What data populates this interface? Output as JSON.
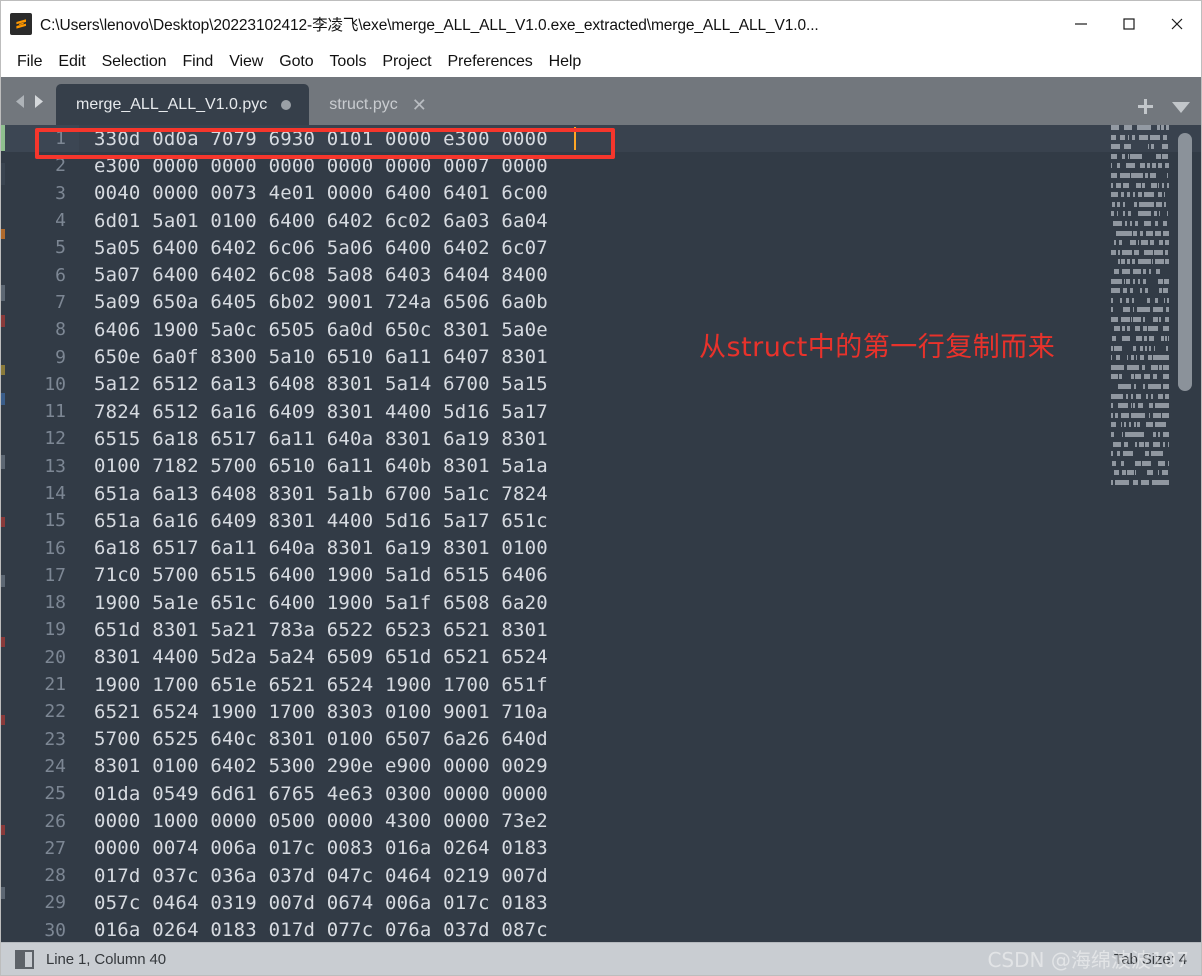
{
  "window": {
    "title": "C:\\Users\\lenovo\\Desktop\\20223102412-李凌飞\\exe\\merge_ALL_ALL_V1.0.exe_extracted\\merge_ALL_ALL_V1.0...",
    "app_icon": "sublime-text-icon",
    "minimize_label": "—",
    "maximize_label": "☐",
    "close_label": "✕"
  },
  "menubar": {
    "items": [
      {
        "label": "File"
      },
      {
        "label": "Edit"
      },
      {
        "label": "Selection"
      },
      {
        "label": "Find"
      },
      {
        "label": "View"
      },
      {
        "label": "Goto"
      },
      {
        "label": "Tools"
      },
      {
        "label": "Project"
      },
      {
        "label": "Preferences"
      },
      {
        "label": "Help"
      }
    ]
  },
  "tabbar": {
    "prev_icon": "chevron-left-icon",
    "next_icon": "chevron-right-icon",
    "new_tab_icon": "plus-icon",
    "tab_menu_icon": "chevron-down-icon",
    "tabs": [
      {
        "label": "merge_ALL_ALL_V1.0.pyc",
        "active": true,
        "dirty": true,
        "close_label": ""
      },
      {
        "label": "struct.pyc",
        "active": false,
        "dirty": false,
        "close_label": "✕"
      }
    ]
  },
  "editor": {
    "cursor_line": 1,
    "lines": [
      {
        "n": "1",
        "text": "330d 0d0a 7079 6930 0101 0000 e300 0000"
      },
      {
        "n": "2",
        "text": "e300 0000 0000 0000 0000 0000 0007 0000"
      },
      {
        "n": "3",
        "text": "0040 0000 0073 4e01 0000 6400 6401 6c00"
      },
      {
        "n": "4",
        "text": "6d01 5a01 0100 6400 6402 6c02 6a03 6a04"
      },
      {
        "n": "5",
        "text": "5a05 6400 6402 6c06 5a06 6400 6402 6c07"
      },
      {
        "n": "6",
        "text": "5a07 6400 6402 6c08 5a08 6403 6404 8400"
      },
      {
        "n": "7",
        "text": "5a09 650a 6405 6b02 9001 724a 6506 6a0b"
      },
      {
        "n": "8",
        "text": "6406 1900 5a0c 6505 6a0d 650c 8301 5a0e"
      },
      {
        "n": "9",
        "text": "650e 6a0f 8300 5a10 6510 6a11 6407 8301"
      },
      {
        "n": "10",
        "text": "5a12 6512 6a13 6408 8301 5a14 6700 5a15"
      },
      {
        "n": "11",
        "text": "7824 6512 6a16 6409 8301 4400 5d16 5a17"
      },
      {
        "n": "12",
        "text": "6515 6a18 6517 6a11 640a 8301 6a19 8301"
      },
      {
        "n": "13",
        "text": "0100 7182 5700 6510 6a11 640b 8301 5a1a"
      },
      {
        "n": "14",
        "text": "651a 6a13 6408 8301 5a1b 6700 5a1c 7824"
      },
      {
        "n": "15",
        "text": "651a 6a16 6409 8301 4400 5d16 5a17 651c"
      },
      {
        "n": "16",
        "text": "6a18 6517 6a11 640a 8301 6a19 8301 0100"
      },
      {
        "n": "17",
        "text": "71c0 5700 6515 6400 1900 5a1d 6515 6406"
      },
      {
        "n": "18",
        "text": "1900 5a1e 651c 6400 1900 5a1f 6508 6a20"
      },
      {
        "n": "19",
        "text": "651d 8301 5a21 783a 6522 6523 6521 8301"
      },
      {
        "n": "20",
        "text": "8301 4400 5d2a 5a24 6509 651d 6521 6524"
      },
      {
        "n": "21",
        "text": "1900 1700 651e 6521 6524 1900 1700 651f"
      },
      {
        "n": "22",
        "text": "6521 6524 1900 1700 8303 0100 9001 710a"
      },
      {
        "n": "23",
        "text": "5700 6525 640c 8301 0100 6507 6a26 640d"
      },
      {
        "n": "24",
        "text": "8301 0100 6402 5300 290e e900 0000 0029"
      },
      {
        "n": "25",
        "text": "01da 0549 6d61 6765 4e63 0300 0000 0000"
      },
      {
        "n": "26",
        "text": "0000 1000 0000 0500 0000 4300 0000 73e2"
      },
      {
        "n": "27",
        "text": "0000 0074 006a 017c 0083 016a 0264 0183"
      },
      {
        "n": "28",
        "text": "017d 037c 036a 037d 047c 0464 0219 007d"
      },
      {
        "n": "29",
        "text": "057c 0464 0319 007d 0674 006a 017c 0183"
      },
      {
        "n": "30",
        "text": "016a 0264 0183 017d 077c 076a 037d 087c"
      }
    ],
    "annotation": "从struct中的第一行复制而来",
    "highlight_box_label": "red-highlight-rectangle"
  },
  "statusbar": {
    "encoding_icon": "split-pane-icon",
    "position": "Line 1, Column 40",
    "tab_size": "Tab Size: 4",
    "watermark": "CSDN @海绵波波107"
  },
  "colors": {
    "accent_red": "#f6362c",
    "editor_bg": "#323b46",
    "tabbar_bg": "#72777d",
    "active_tab_bg": "#363f4a",
    "statusbar_bg": "#c9cdd2",
    "caret": "#ffa726",
    "code_fg": "#d6dae0",
    "line_number_fg": "#7d8794"
  }
}
